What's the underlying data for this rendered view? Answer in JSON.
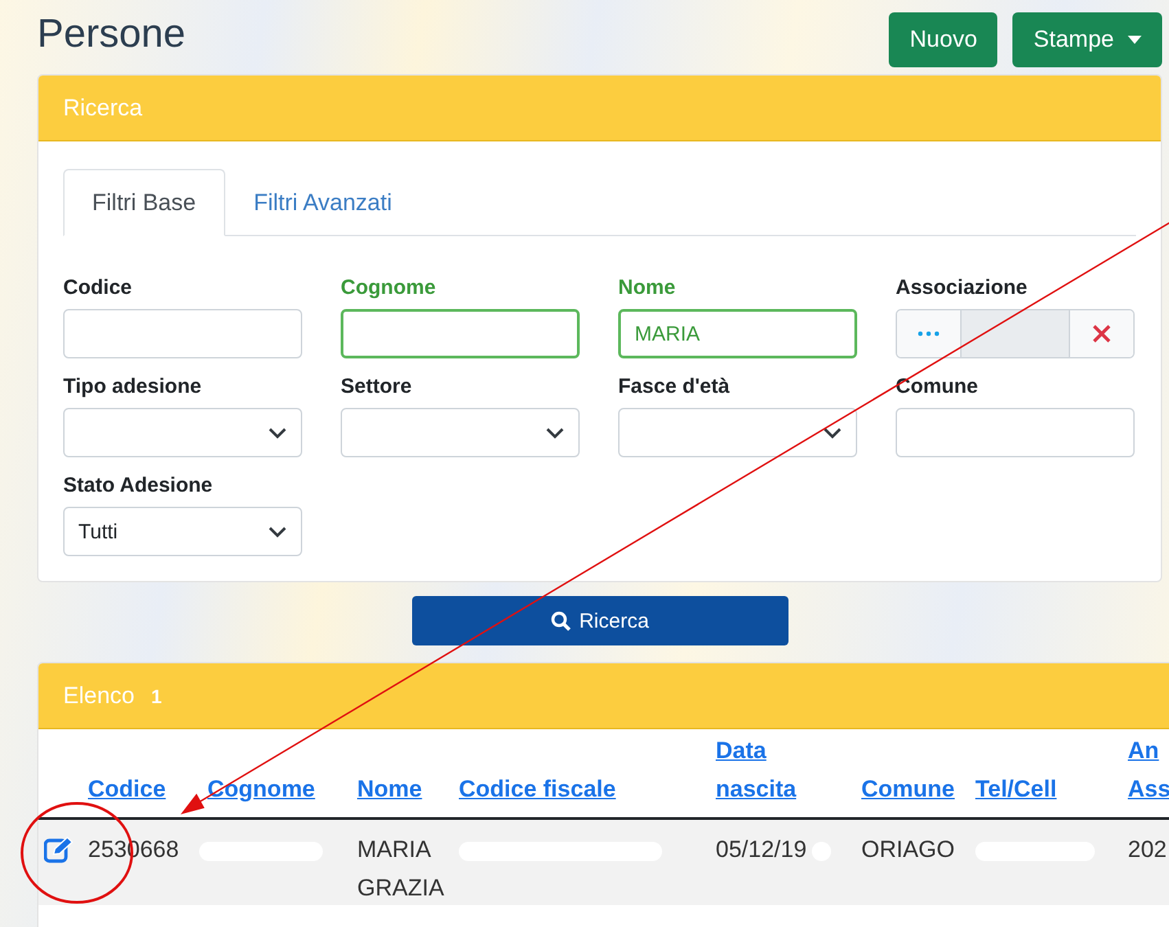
{
  "page": {
    "title": "Persone"
  },
  "actions": [
    {
      "label": "Nuovo",
      "kind": "button"
    },
    {
      "label": "Stampe",
      "kind": "dropdown"
    }
  ],
  "search": {
    "title": "Ricerca",
    "tabs": [
      {
        "label": "Filtri Base",
        "selected": true
      },
      {
        "label": "Filtri Avanzati",
        "selected": false
      }
    ],
    "fields": [
      {
        "label": "Codice",
        "kind": "text",
        "valid": false
      },
      {
        "label": "Cognome",
        "kind": "text",
        "valid": true
      },
      {
        "label": "Nome",
        "kind": "text",
        "valid": true,
        "value": "MARIA"
      },
      {
        "label": "Associazione",
        "kind": "lookup",
        "valid": false
      },
      {
        "label": "Tipo adesione",
        "kind": "select",
        "valid": false
      },
      {
        "label": "Settore",
        "kind": "select",
        "valid": false
      },
      {
        "label": "Fasce d'età",
        "kind": "select",
        "valid": false
      },
      {
        "label": "Comune",
        "kind": "text",
        "valid": false
      },
      {
        "label": "Stato Adesione",
        "kind": "select",
        "valid": false,
        "value": "Tutti"
      }
    ],
    "submit": "Ricerca"
  },
  "results": {
    "title": "Elenco",
    "count": "1",
    "columns": [
      "Codice",
      "Cognome",
      "Nome",
      "Codice fiscale",
      "Data\nnascita",
      "Comune",
      "Tel/Cell",
      "An\nAss"
    ],
    "rows": [
      {
        "cells": [
          {
            "text": "2530668"
          },
          {
            "redacted": true
          },
          {
            "text": "MARIA GRAZIA"
          },
          {
            "redacted": true
          },
          {
            "text": "05/12/19",
            "redacted": true
          },
          {
            "text": "ORIAGO"
          },
          {
            "redacted": true
          },
          {
            "text": "202"
          }
        ]
      }
    ]
  }
}
